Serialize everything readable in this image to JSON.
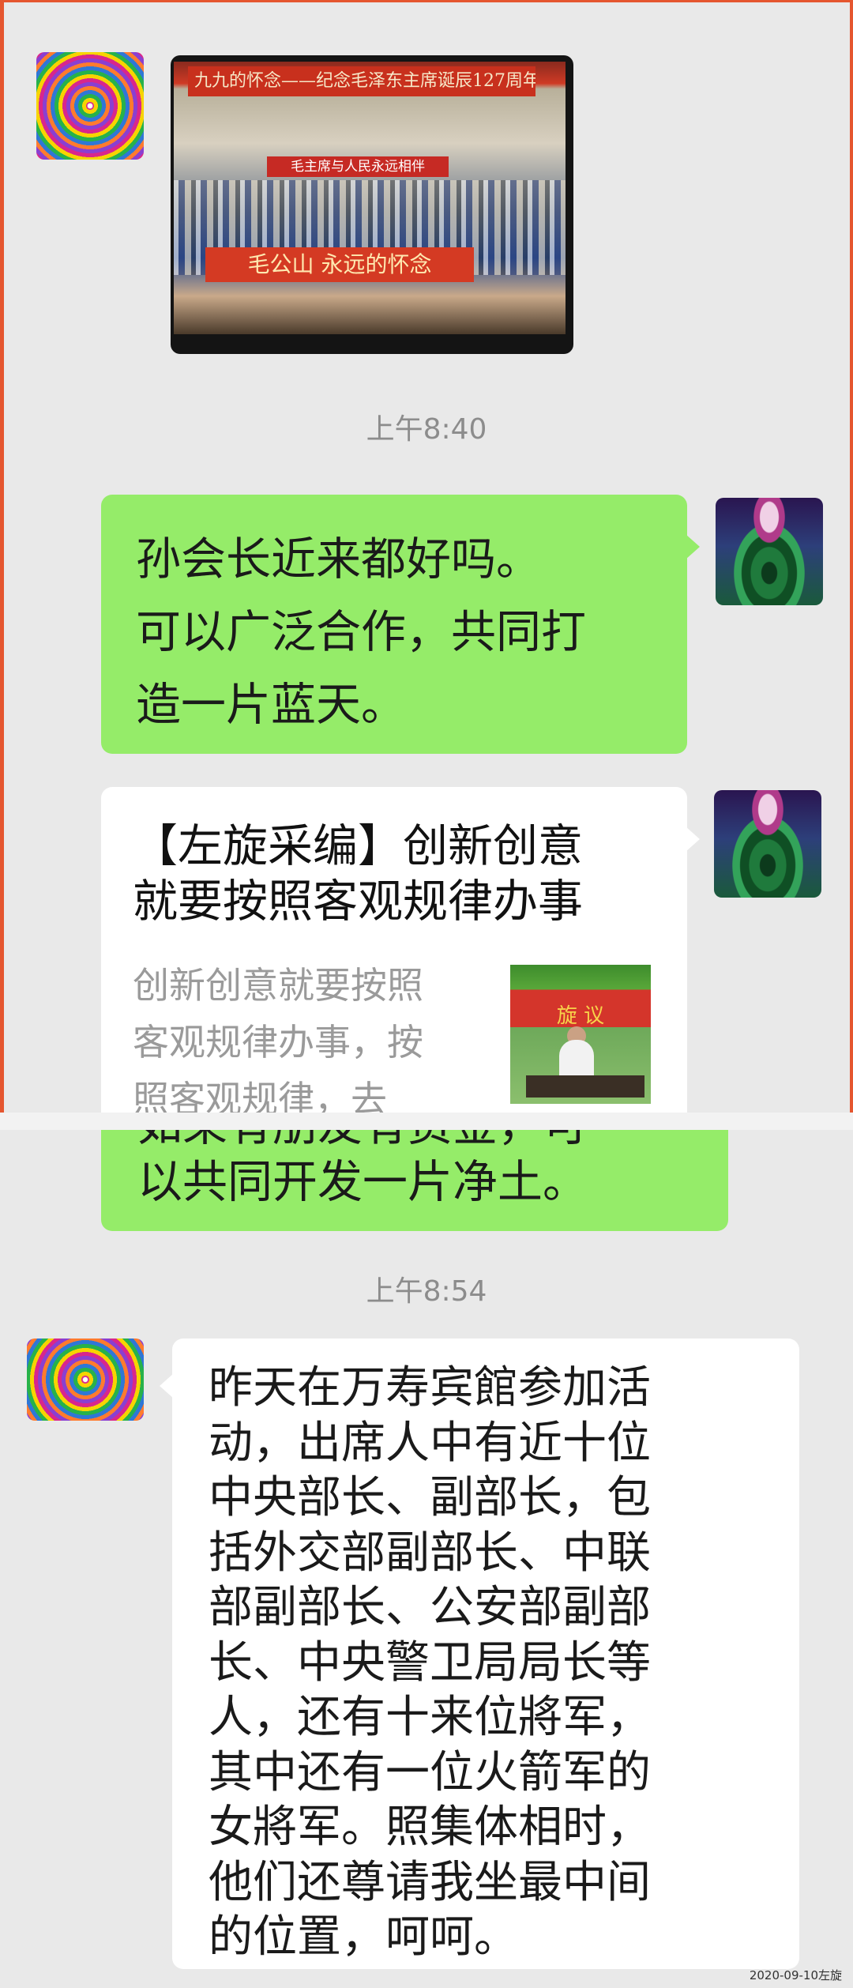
{
  "messages": {
    "m1": {
      "photo_banner_top": "九九的怀念——纪念毛泽东主席诞辰127周年",
      "photo_banner_mid": "毛主席与人民永远相伴",
      "photo_banner_bottom": "毛公山 永远的怀念"
    },
    "time1": "上午8:40",
    "m2": {
      "text": "孙会长近来都好吗。\n可以广泛合作，共同打\n造一片蓝天。"
    },
    "m3": {
      "title": "【左旋采编】创新创意\n就要按照客观规律办事",
      "description": "创新创意就要按照\n客观规律办事，按\n照客观规律，去",
      "thumb_banner": "旋 议"
    },
    "m4": {
      "text": "如果有朋友有资金，可\n以共同开发一片净土。"
    },
    "time2": "上午8:54",
    "m5": {
      "text": "昨天在万寿宾館参加活\n动，出席人中有近十位\n中央部长、副部长，包\n括外交部副部长、中联\n部副部长、公安部副部\n长、中央警卫局局长等\n人，还有十来位將军，\n其中还有一位火箭军的\n女將军。照集体相时，\n他们还尊请我坐最中间\n的位置，呵呵。"
    }
  },
  "avatars": {
    "contact": "swirl-avatar",
    "self": "lotus-avatar"
  },
  "watermark": "2020-09-10左旋",
  "colors": {
    "bubble_self": "#95ec69",
    "bubble_other": "#ffffff",
    "background": "#e9e9e9",
    "edge": "#e5562f"
  }
}
